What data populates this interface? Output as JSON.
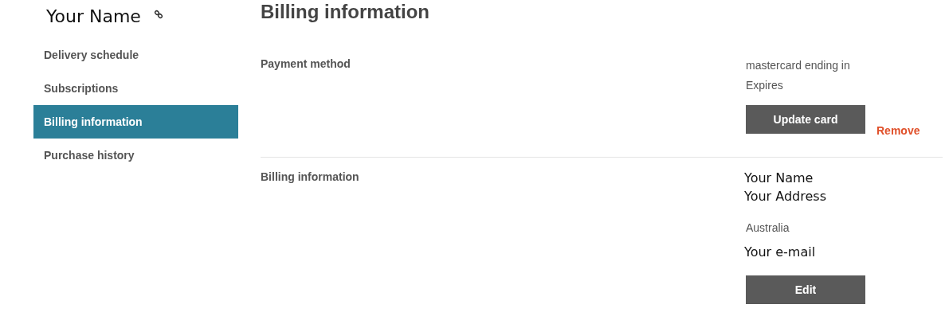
{
  "account_name": "Your Name",
  "sidebar": {
    "items": [
      {
        "label": "Delivery schedule",
        "selected": false
      },
      {
        "label": "Subscriptions",
        "selected": false
      },
      {
        "label": "Billing information",
        "selected": true
      },
      {
        "label": "Purchase history",
        "selected": false
      }
    ]
  },
  "page_title": "Billing information",
  "sections": [
    {
      "label": "Payment method",
      "details": [
        {
          "kind": "muted",
          "text": "mastercard ending in"
        },
        {
          "kind": "muted",
          "text": "Expires"
        },
        {
          "kind": "button",
          "text": "Update card",
          "link": "Remove"
        }
      ]
    },
    {
      "label": "Billing information",
      "details": [
        {
          "kind": "strong",
          "text": "Your Name"
        },
        {
          "kind": "strong",
          "text": "Your Address"
        },
        {
          "kind": "muted",
          "text": "Australia"
        },
        {
          "kind": "strong",
          "text": "Your e-mail"
        },
        {
          "kind": "button",
          "text": "Edit"
        }
      ]
    }
  ]
}
